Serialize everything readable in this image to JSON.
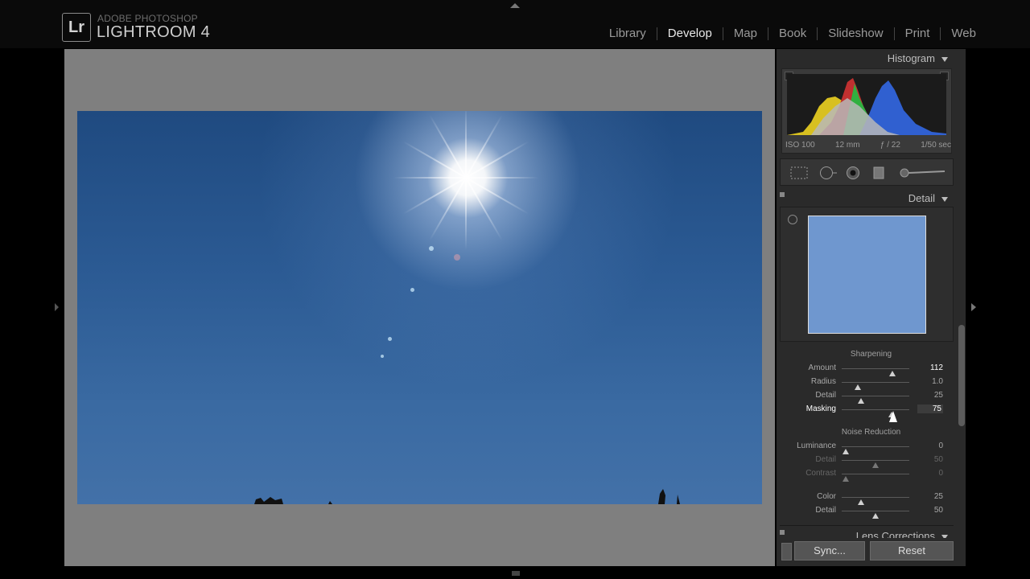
{
  "app": {
    "logo": "Lr",
    "brand_small": "ADOBE PHOTOSHOP",
    "brand_big": "LIGHTROOM 4"
  },
  "modules": [
    "Library",
    "Develop",
    "Map",
    "Book",
    "Slideshow",
    "Print",
    "Web"
  ],
  "active_module": "Develop",
  "histogram": {
    "title": "Histogram",
    "exif": [
      "ISO 100",
      "12 mm",
      "ƒ / 22",
      "1/50 sec"
    ]
  },
  "detail": {
    "title": "Detail",
    "sharpening": {
      "title": "Sharpening",
      "amount": {
        "label": "Amount",
        "value": "112",
        "level": 0.75
      },
      "radius": {
        "label": "Radius",
        "value": "1.0",
        "level": 0.24
      },
      "detail": {
        "label": "Detail",
        "value": "25",
        "level": 0.28
      },
      "masking": {
        "label": "Masking",
        "value": "75",
        "level": 0.74
      }
    },
    "noise_reduction": {
      "title": "Noise Reduction",
      "luminance": {
        "label": "Luminance",
        "value": "0",
        "level": 0.06
      },
      "lum_detail": {
        "label": "Detail",
        "value": "50",
        "level": 0.5
      },
      "lum_contrast": {
        "label": "Contrast",
        "value": "0",
        "level": 0.06
      },
      "color": {
        "label": "Color",
        "value": "25",
        "level": 0.28
      },
      "color_detail": {
        "label": "Detail",
        "value": "50",
        "level": 0.5
      }
    }
  },
  "lens_corrections": {
    "title": "Lens Corrections"
  },
  "buttons": {
    "sync": "Sync...",
    "reset": "Reset"
  }
}
